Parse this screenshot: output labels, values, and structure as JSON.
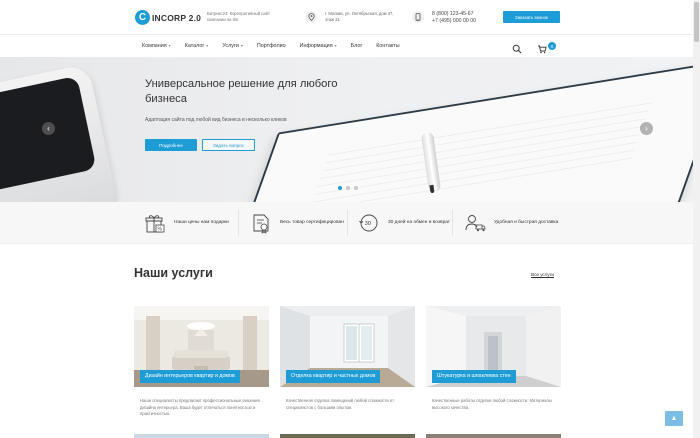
{
  "header": {
    "logo_text": "INCORP 2.0",
    "tagline": "Битрикс24: Корпоративный сайт компании на ibs",
    "address": "г. Москва, ул. Октябрьская, дом 47, этаж 21",
    "phone_1": "8 (800) 123-45-67",
    "phone_2": "+7 (495) 000 00 00",
    "callback_label": "Заказать звонок"
  },
  "nav": {
    "items": [
      {
        "label": "Компания",
        "has_dropdown": true
      },
      {
        "label": "Каталог",
        "has_dropdown": true
      },
      {
        "label": "Услуги",
        "has_dropdown": true
      },
      {
        "label": "Портфолио",
        "has_dropdown": false
      },
      {
        "label": "Информация",
        "has_dropdown": true
      },
      {
        "label": "Блог",
        "has_dropdown": false
      },
      {
        "label": "Контакты",
        "has_dropdown": false
      }
    ],
    "cart_count": "0"
  },
  "hero": {
    "title": "Универсальное решение для любого бизнеса",
    "subtitle": "Адаптация сайта под любой вид бизнеса в несколько кликов",
    "primary_button": "Подробнее",
    "secondary_button": "Задать вопрос",
    "prev_arrow": "‹",
    "next_arrow": "›",
    "active_slide": 1,
    "slide_count": 3
  },
  "features": [
    {
      "text": "Наши цены нам подарки",
      "icon": "gift-icon"
    },
    {
      "text": "Весь товар сертифицирован",
      "icon": "certificate-icon"
    },
    {
      "text": "30 дней на обмен и возврат",
      "icon": "return-30-icon"
    },
    {
      "text": "Удобная и быстрая доставка",
      "icon": "delivery-icon"
    }
  ],
  "services": {
    "title": "Наши услуги",
    "all_link": "Все услуги",
    "cards": [
      {
        "label": "Дизайн интерьеров квартир и домов",
        "desc": "Наши специалисты предлагают профессиональные решения дизайна интерьера. Ваша будет отличаться понятностью и практичностью."
      },
      {
        "label": "Отделка квартир и частных домов",
        "desc": "Качественная отделка помещений любой сложности от специалистов с большим опытом."
      },
      {
        "label": "Штукатурка и шпаклевка стен",
        "desc": "Качественные работы отделки любой сложности. Материалы высокого качества."
      }
    ]
  },
  "colors": {
    "accent": "#1e9cd6",
    "text": "#333333",
    "muted": "#777777"
  },
  "scroll_top": "▲"
}
